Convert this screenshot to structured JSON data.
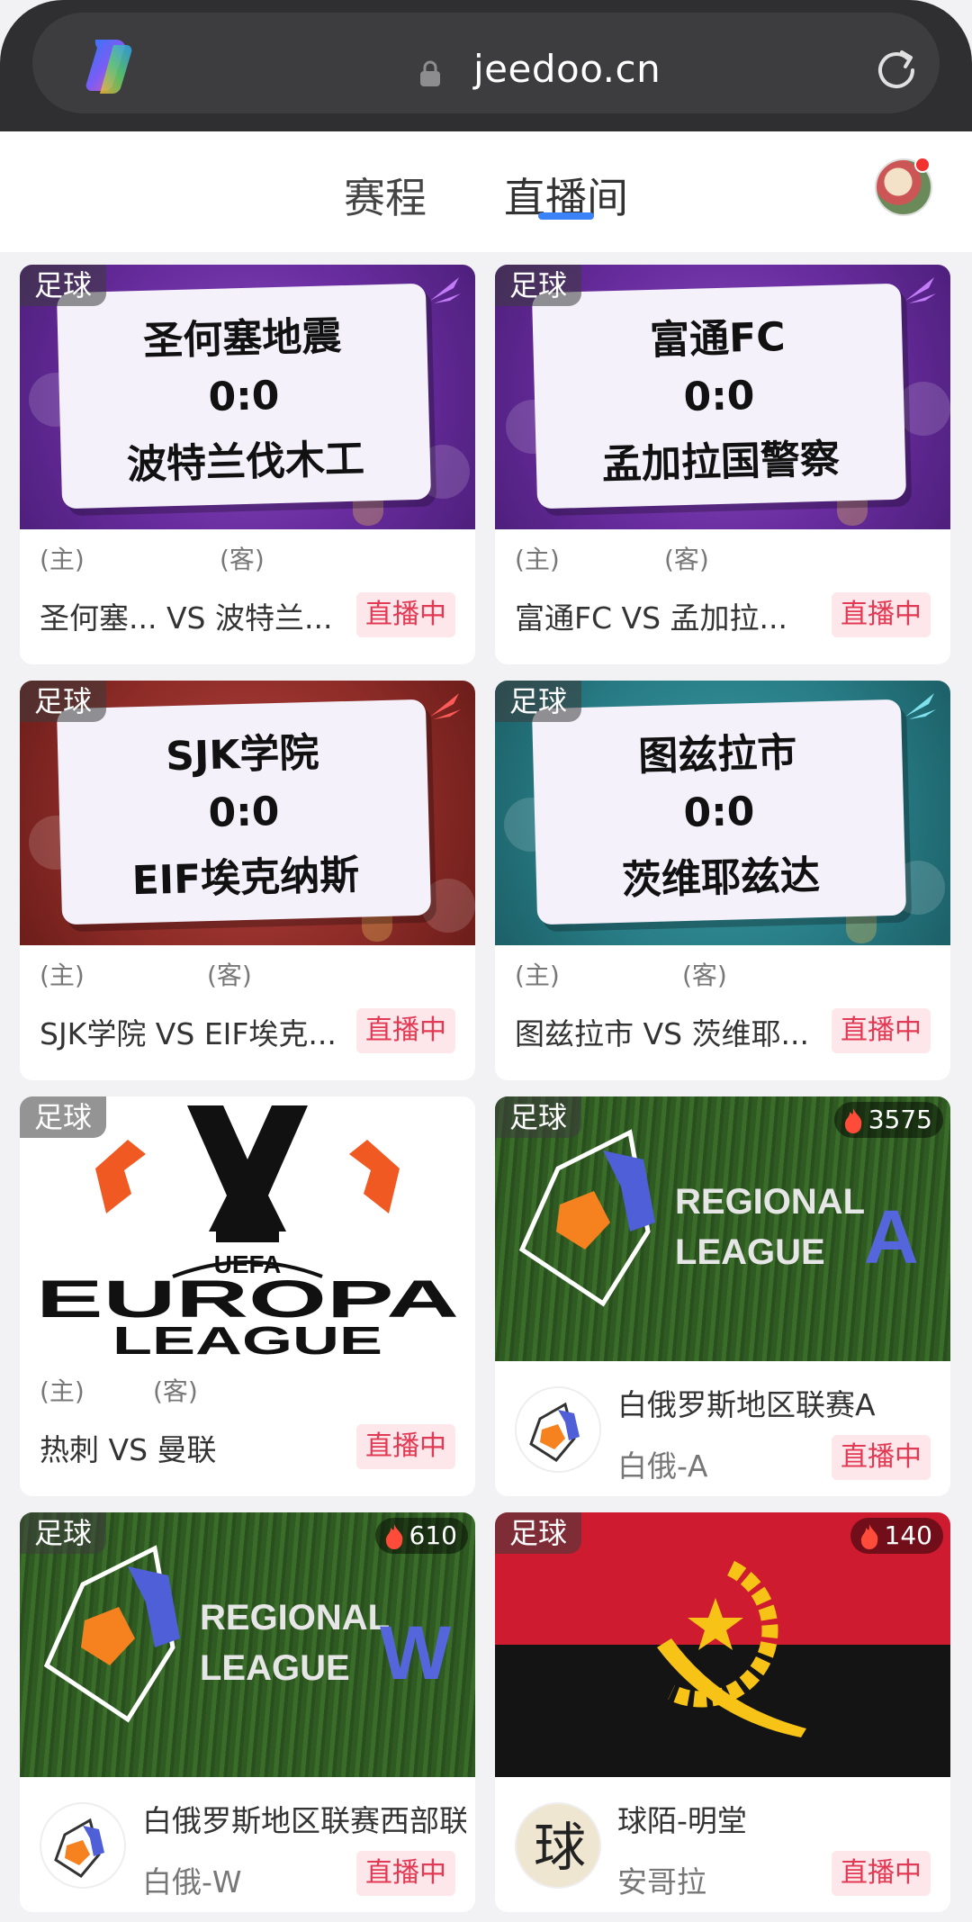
{
  "browser": {
    "url": "jeedoo.cn"
  },
  "nav": {
    "tabs": [
      {
        "label": "赛程"
      },
      {
        "label": "直播间"
      }
    ],
    "active_tab": "直播间"
  },
  "labels": {
    "home": "(主)",
    "away": "(客)",
    "live": "直播中"
  },
  "matches": [
    {
      "sport": "足球",
      "home": "圣何塞地震",
      "score": "0:0",
      "away": "波特兰伐木工",
      "summary": "圣何塞... VS 波特兰...",
      "theme": "purple",
      "accent": "#b46bf0"
    },
    {
      "sport": "足球",
      "home": "富通FC",
      "score": "0:0",
      "away": "孟加拉国警察",
      "summary": "富通FC VS 孟加拉...",
      "theme": "purple",
      "accent": "#b46bf0"
    },
    {
      "sport": "足球",
      "home": "SJK学院",
      "score": "0:0",
      "away": "EIF埃克纳斯",
      "summary": "SJK学院 VS EIF埃克...",
      "theme": "red",
      "accent": "#f05050"
    },
    {
      "sport": "足球",
      "home": "图兹拉市",
      "score": "0:0",
      "away": "茨维耶兹达",
      "summary": "图兹拉市 VS 茨维耶...",
      "theme": "teal",
      "accent": "#6fd3e0"
    },
    {
      "sport": "足球",
      "summary": "热刺 VS 曼联",
      "logo_line1": "UEFA",
      "logo_line2": "EUROPA",
      "logo_line3": "LEAGUE"
    }
  ],
  "rooms": [
    {
      "sport": "足球",
      "heat": "3575",
      "title": "白俄罗斯地区联赛A",
      "subtitle": "白俄-A",
      "banner_line1": "REGIONAL",
      "banner_line2": "LEAGUE",
      "banner_letter": "A"
    },
    {
      "sport": "足球",
      "heat": "610",
      "title": "白俄罗斯地区联赛西部联",
      "subtitle": "白俄-W",
      "banner_line1": "REGIONAL",
      "banner_line2": "LEAGUE",
      "banner_letter": "W"
    },
    {
      "sport": "足球",
      "heat": "140",
      "title": "球陌-明堂",
      "subtitle": "安哥拉",
      "avatar_char": "球"
    }
  ]
}
